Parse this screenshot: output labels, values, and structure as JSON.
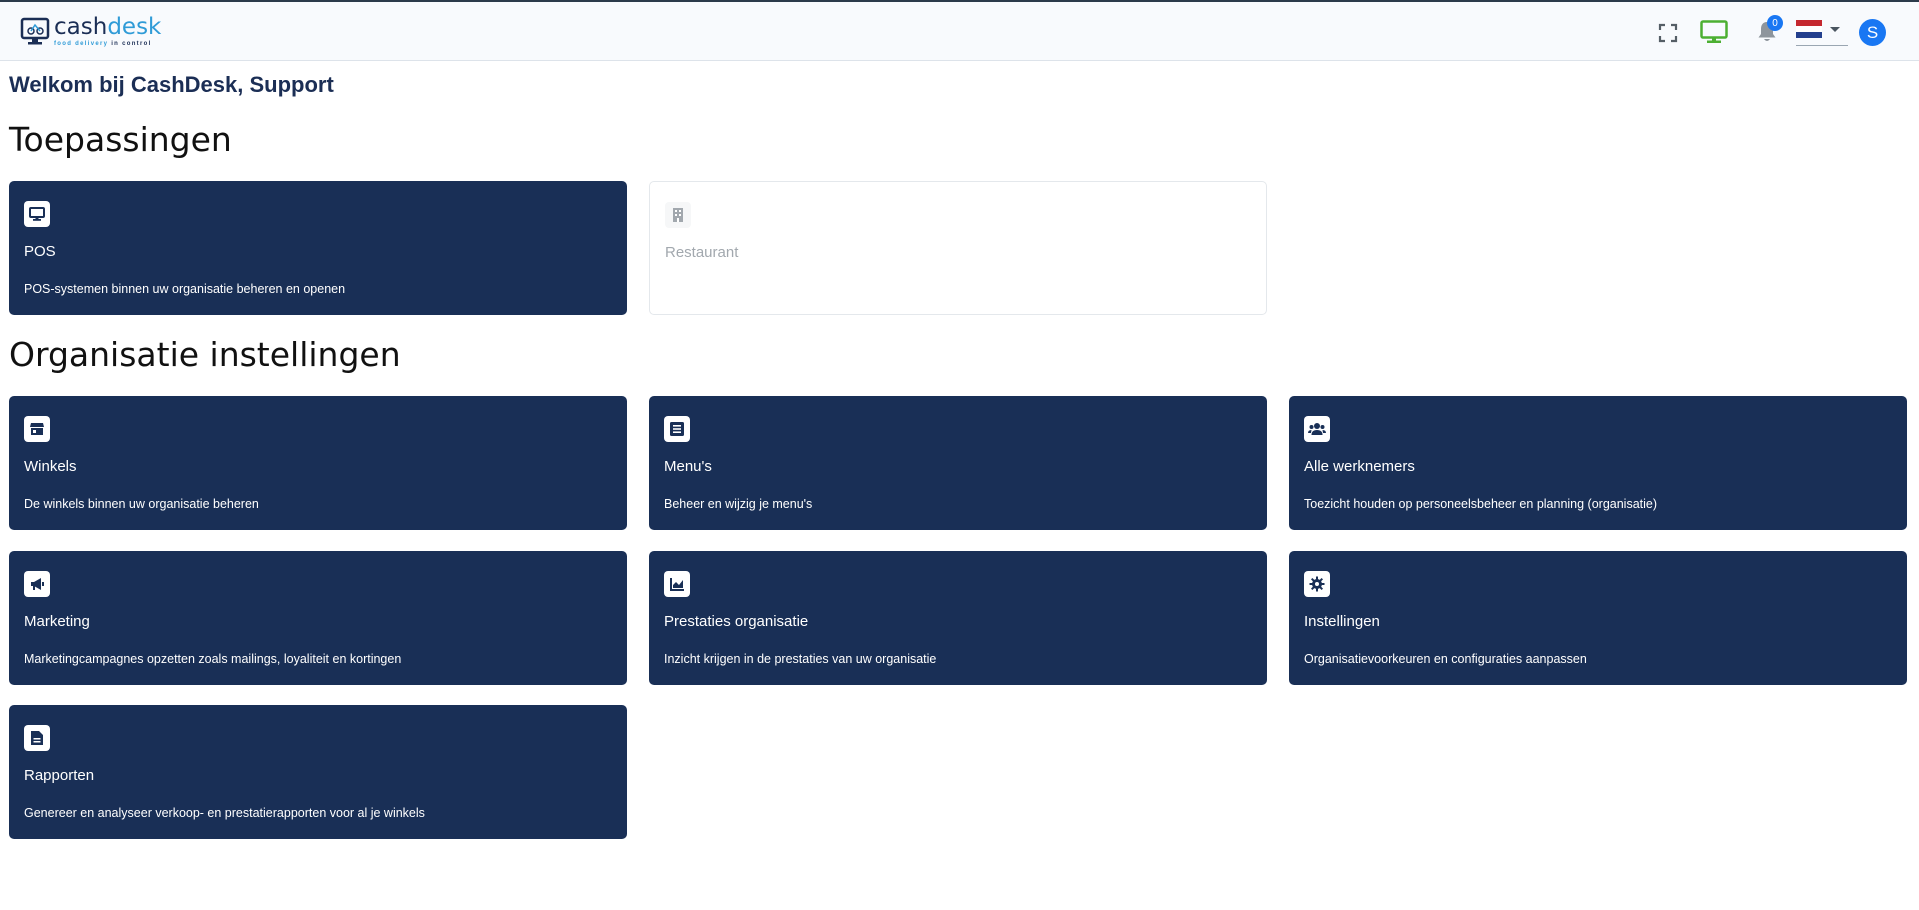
{
  "header": {
    "logo": {
      "word_part1": "cash",
      "word_part2": "desk",
      "tagline_part1": "food delivery",
      "tagline_part2": " in control"
    },
    "notifications_count": "0",
    "avatar_initial": "S",
    "colors": {
      "brand_dark": "#1b2e55",
      "brand_light": "#2f9bd7",
      "monitor_green": "#4caf32",
      "accent_blue": "#1977f3"
    }
  },
  "welcome": "Welkom bij CashDesk, Support",
  "applications": {
    "title": "Toepassingen",
    "cards": [
      {
        "icon": "monitor-icon",
        "title": "POS",
        "description": "POS-systemen binnen uw organisatie beheren en openen",
        "enabled": true
      },
      {
        "icon": "building-icon",
        "title": "Restaurant",
        "description": "",
        "enabled": false
      }
    ]
  },
  "organization": {
    "title": "Organisatie instellingen",
    "cards": [
      {
        "icon": "store-icon",
        "title": "Winkels",
        "description": "De winkels binnen uw organisatie beheren"
      },
      {
        "icon": "menu-list-icon",
        "title": "Menu's",
        "description": "Beheer en wijzig je menu's"
      },
      {
        "icon": "users-icon",
        "title": "Alle werknemers",
        "description": "Toezicht houden op personeelsbeheer en planning (organisatie)"
      },
      {
        "icon": "megaphone-icon",
        "title": "Marketing",
        "description": "Marketingcampagnes opzetten zoals mailings, loyaliteit en kortingen"
      },
      {
        "icon": "chart-icon",
        "title": "Prestaties organisatie",
        "description": "Inzicht krijgen in de prestaties van uw organisatie"
      },
      {
        "icon": "gear-icon",
        "title": "Instellingen",
        "description": "Organisatievoorkeuren en configuraties aanpassen"
      },
      {
        "icon": "report-file-icon",
        "title": "Rapporten",
        "description": "Genereer en analyseer verkoop- en prestatierapporten voor al je winkels"
      }
    ]
  }
}
